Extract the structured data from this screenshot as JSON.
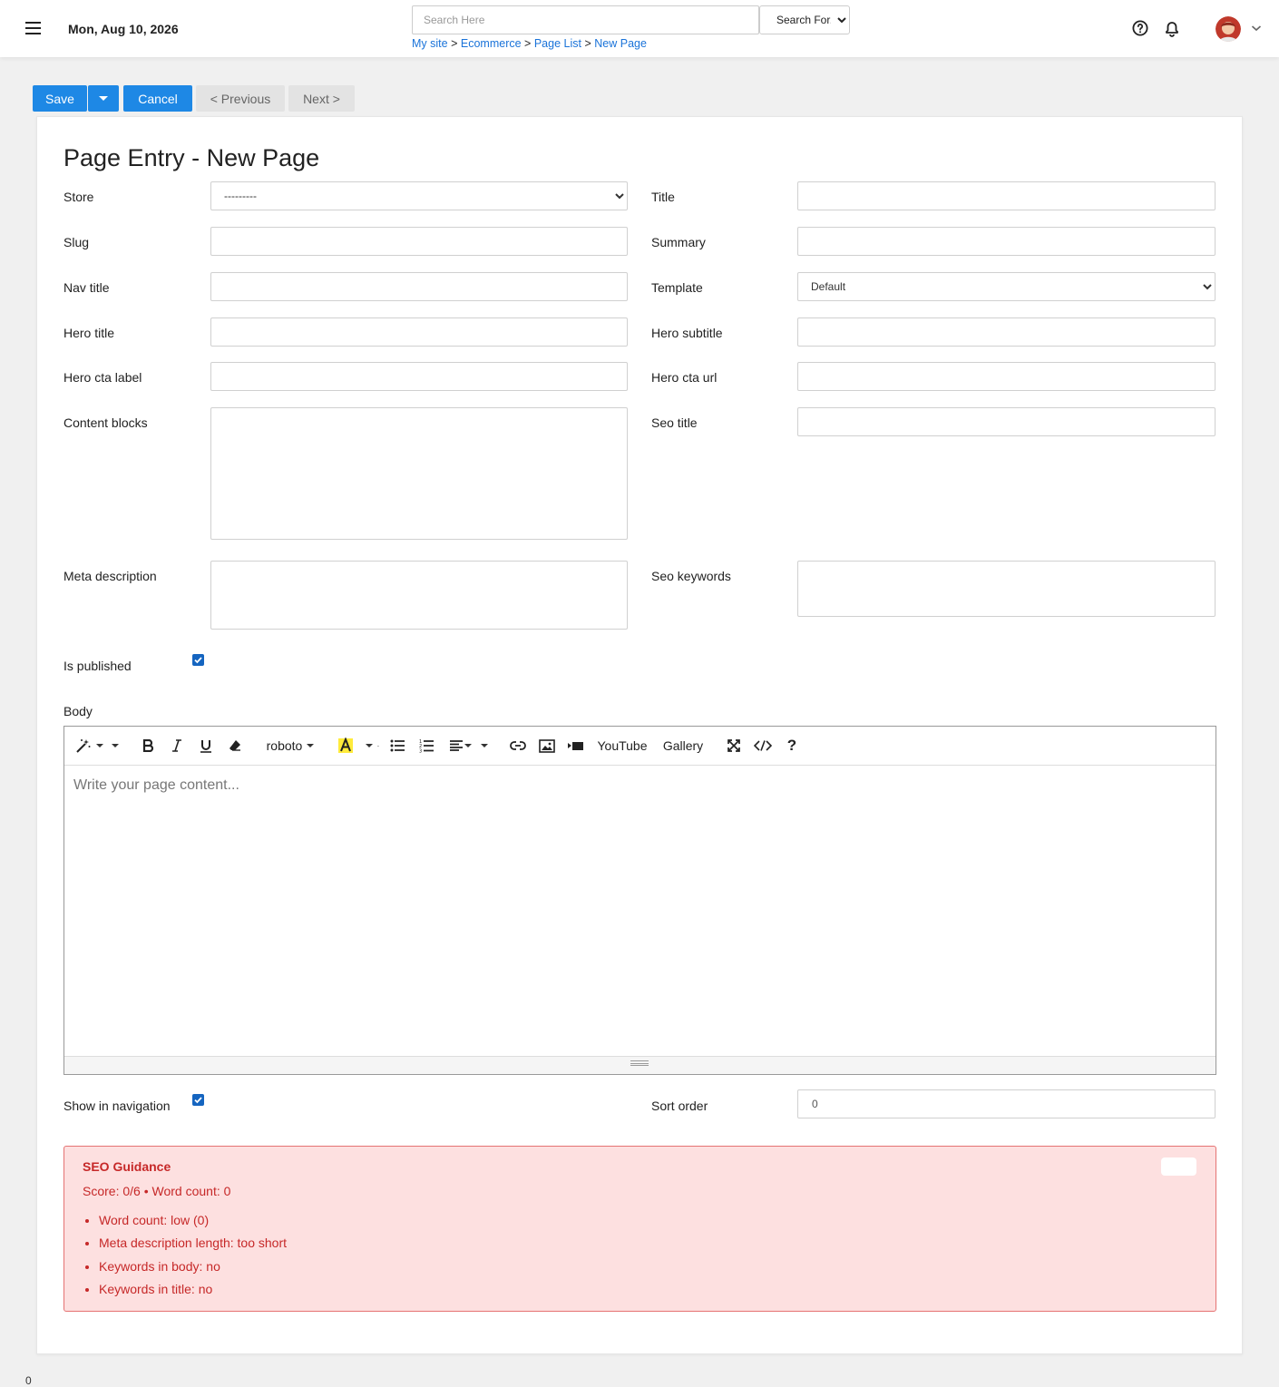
{
  "header": {
    "date": "Mon, Aug 10, 2026",
    "search_placeholder": "Search Here",
    "search_scope": "Search For...",
    "breadcrumb": [
      {
        "label": "My site"
      },
      {
        "label": "Ecommerce"
      },
      {
        "label": "Page List"
      },
      {
        "label": "New Page"
      }
    ],
    "breadcrumb_separator": ">"
  },
  "actions": {
    "save": "Save",
    "cancel": "Cancel",
    "previous": "< Previous",
    "next": "Next >"
  },
  "form": {
    "title": "Page Entry - New Page",
    "fields": {
      "store": {
        "label": "Store",
        "value": "---------"
      },
      "title": {
        "label": "Title",
        "value": ""
      },
      "slug": {
        "label": "Slug",
        "value": ""
      },
      "summary": {
        "label": "Summary",
        "value": ""
      },
      "nav_title": {
        "label": "Nav title",
        "value": ""
      },
      "template": {
        "label": "Template",
        "value": "Default"
      },
      "hero_title": {
        "label": "Hero title",
        "value": ""
      },
      "hero_subtitle": {
        "label": "Hero subtitle",
        "value": ""
      },
      "hero_cta_label": {
        "label": "Hero cta label",
        "value": ""
      },
      "hero_cta_url": {
        "label": "Hero cta url",
        "value": ""
      },
      "content_blocks": {
        "label": "Content blocks",
        "value": ""
      },
      "seo_title": {
        "label": "Seo title",
        "value": ""
      },
      "meta_description": {
        "label": "Meta description",
        "value": ""
      },
      "seo_keywords": {
        "label": "Seo keywords",
        "value": ""
      },
      "is_published": {
        "label": "Is published",
        "checked": true
      },
      "body": {
        "label": "Body"
      },
      "show_in_navigation": {
        "label": "Show in navigation",
        "checked": true
      },
      "sort_order": {
        "label": "Sort order",
        "value": "0"
      }
    }
  },
  "editor": {
    "font_name": "roboto",
    "youtube": "YouTube",
    "gallery": "Gallery",
    "help": "?",
    "placeholder": "Write your page content..."
  },
  "seo": {
    "title": "SEO Guidance",
    "score": "Score: 0/6 • Word count: 0",
    "items": [
      "Word count: low (0)",
      "Meta description length: too short",
      "Keywords in body: no",
      "Keywords in title: no"
    ]
  },
  "footer": {
    "mark": "0"
  },
  "colors": {
    "primary": "#1e88e5",
    "link": "#1a73d9",
    "alert_bg": "#fde0e0",
    "alert_border": "#e57373",
    "alert_text": "#c62828",
    "checkbox": "#1565c0"
  }
}
